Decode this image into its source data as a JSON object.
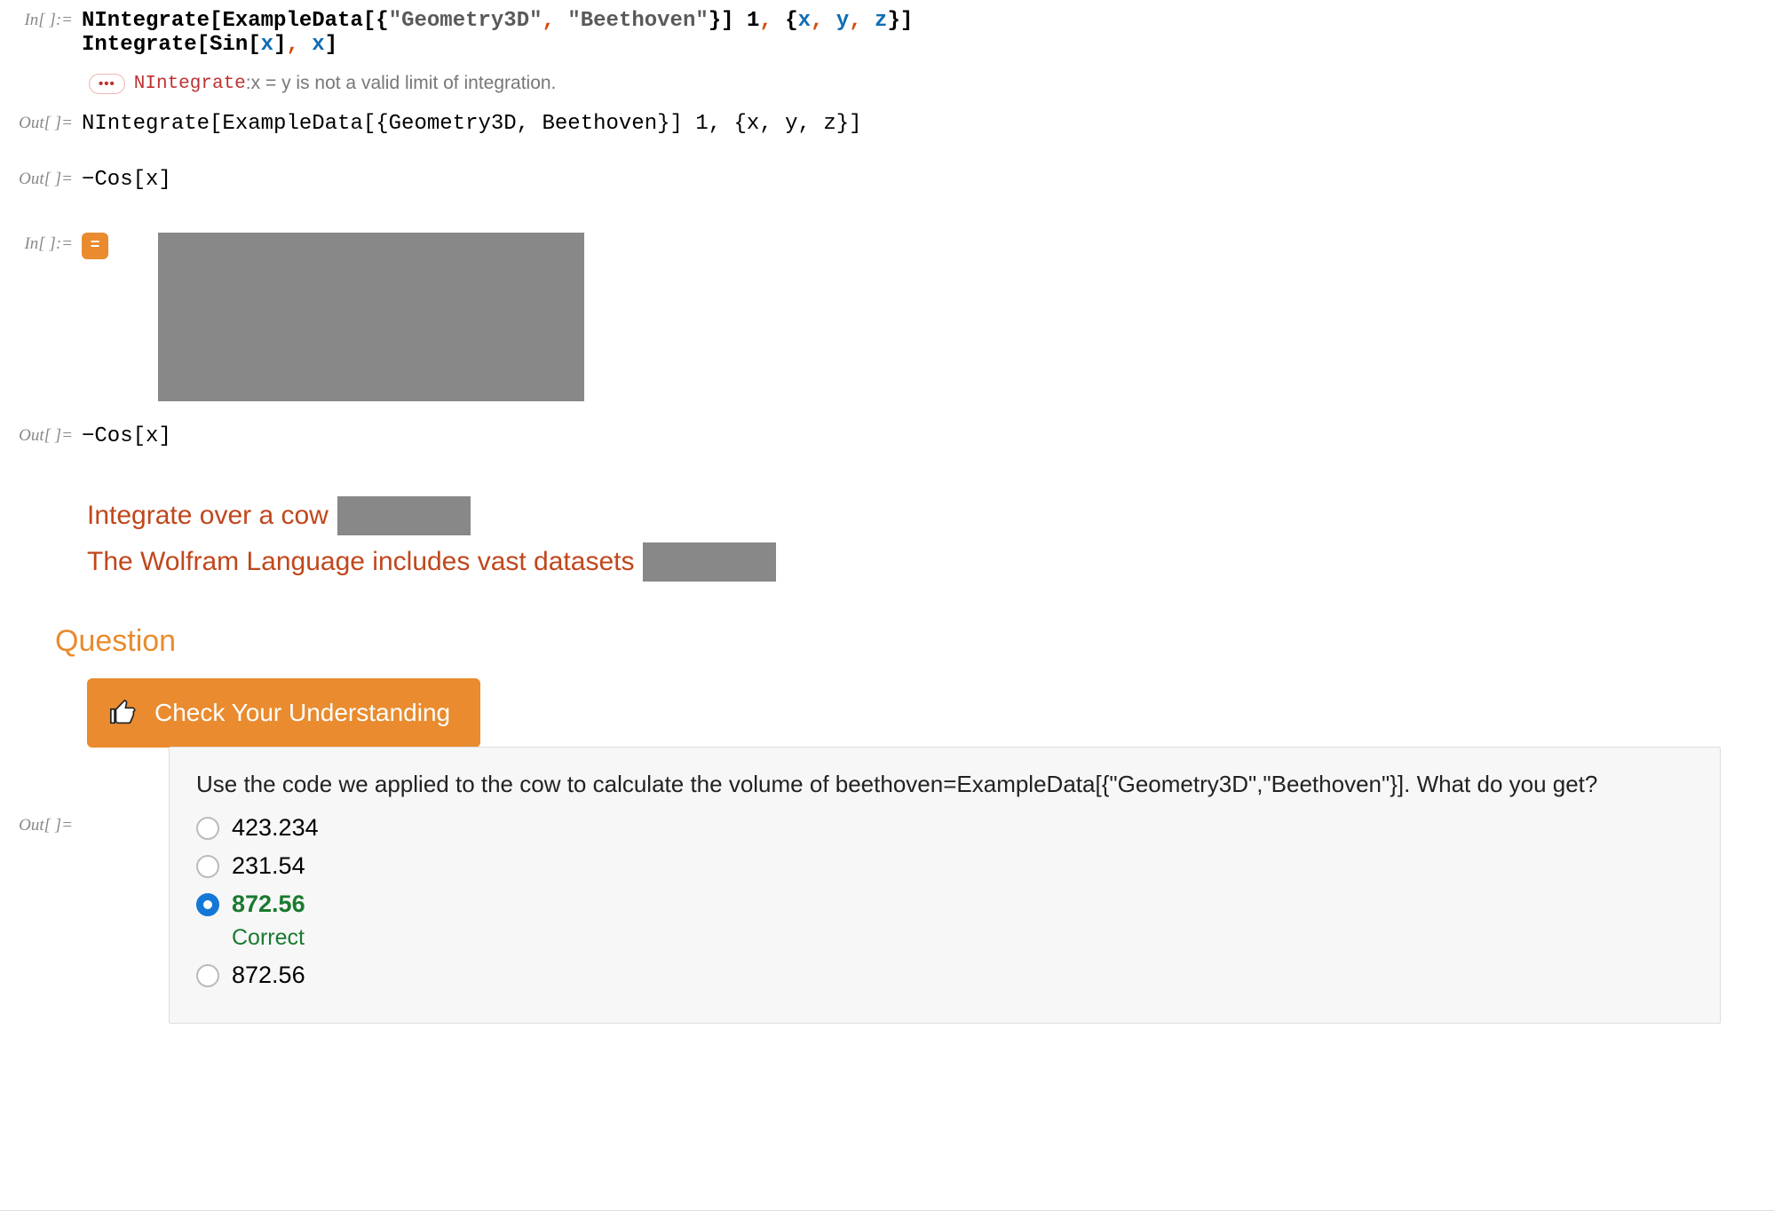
{
  "labels": {
    "in": "In[ ]:=",
    "out": "Out[ ]="
  },
  "cell1": {
    "fn1": "NIntegrate",
    "open1": "[",
    "fn2": "ExampleData",
    "open2": "[{",
    "str1": "\"Geometry3D\"",
    "comma1": ",",
    "sp1": " ",
    "str2": "\"Beethoven\"",
    "close2": "}]",
    "sp2": " ",
    "one": "1",
    "comma2": ",",
    "sp3": " ",
    "open3": "{",
    "x": "x",
    "comma3": ",",
    "sp4": " ",
    "y": "y",
    "comma4": ",",
    "sp5": " ",
    "z": "z",
    "close3": "}",
    "close1": "]",
    "line2_fn": "Integrate",
    "line2_open": "[",
    "line2_sin": "Sin",
    "line2_sopen": "[",
    "line2_x": "x",
    "line2_sclose": "]",
    "line2_comma": ",",
    "line2_sp": " ",
    "line2_x2": "x",
    "line2_close": "]"
  },
  "msg": {
    "dots": "•••",
    "name": "NIntegrate",
    "colon": ": ",
    "body": "x = y is not a valid limit of integration."
  },
  "out1": {
    "text": "NIntegrate[ExampleData[{Geometry3D, Beethoven}] 1, {x, y, z}]"
  },
  "out2": {
    "neg": "−",
    "fn": "Cos",
    "open": "[",
    "x": "x",
    "close": "]"
  },
  "icon_badge": "=",
  "out3": {
    "neg": "−",
    "fn": "Cos",
    "open": "[",
    "x": "x",
    "close": "]"
  },
  "links": {
    "l1": "Integrate over a cow",
    "l2": "The Wolfram Language includes vast datasets"
  },
  "question_heading": "Question",
  "cyu": "Check Your Understanding",
  "quiz": {
    "prompt": "Use the code we applied to the cow to calculate the volume of beethoven=ExampleData[{\"Geometry3D\",\"Beethoven\"}]. What do you get?",
    "opts": [
      "423.234",
      "231.54",
      "872.56",
      "872.56"
    ],
    "selected_index": 2,
    "correct_text": "Correct"
  }
}
